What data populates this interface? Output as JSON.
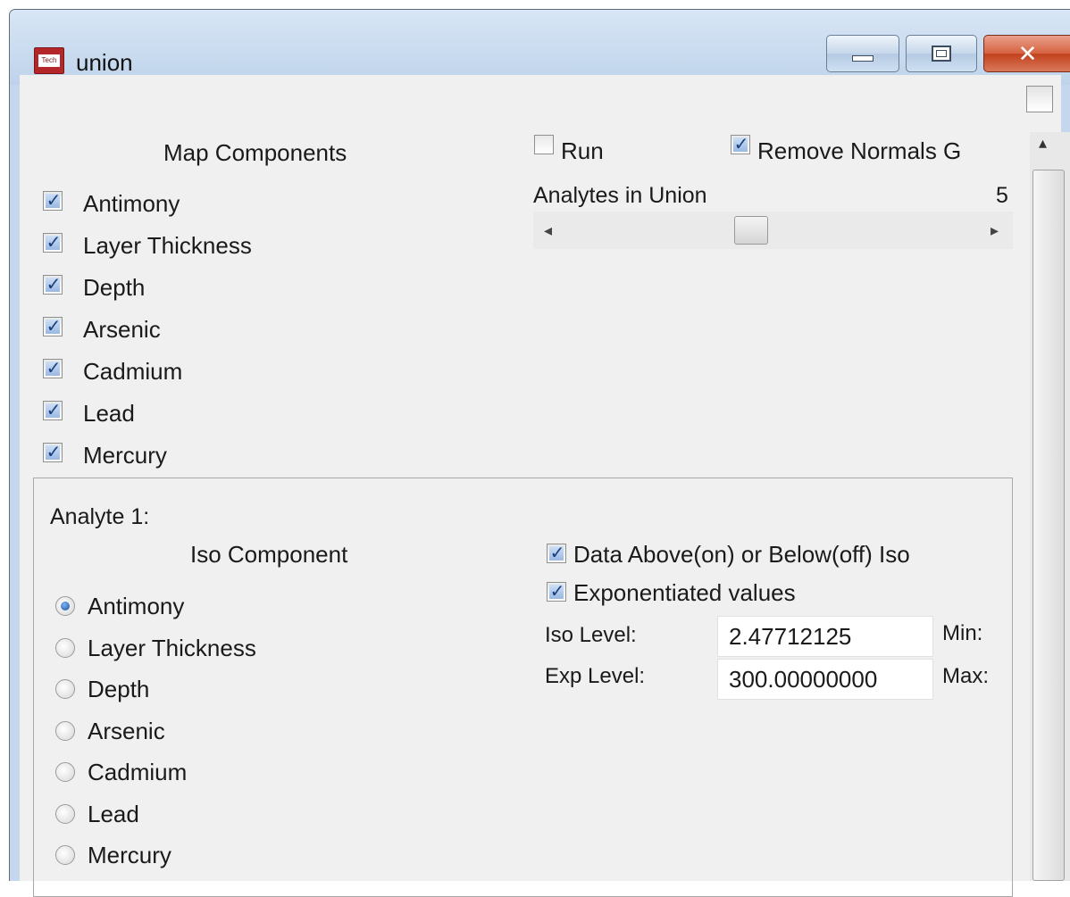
{
  "window": {
    "title": "union",
    "icon_text": "Tech",
    "close_glyph": "✕"
  },
  "map_components": {
    "heading": "Map Components",
    "items": [
      {
        "label": "Antimony",
        "checked": true
      },
      {
        "label": "Layer Thickness",
        "checked": true
      },
      {
        "label": "Depth",
        "checked": true
      },
      {
        "label": "Arsenic",
        "checked": true
      },
      {
        "label": "Cadmium",
        "checked": true
      },
      {
        "label": "Lead",
        "checked": true
      },
      {
        "label": "Mercury",
        "checked": true
      }
    ]
  },
  "options": {
    "run_label": "Run",
    "run_checked": false,
    "remove_normals_label": "Remove Normals G",
    "remove_normals_checked": true,
    "analytes_in_union_label": "Analytes in Union",
    "analytes_in_union_value": "5"
  },
  "analyte": {
    "group_label": "Analyte 1:",
    "iso_component_heading": "Iso Component",
    "components": [
      {
        "label": "Antimony",
        "selected": true
      },
      {
        "label": "Layer Thickness",
        "selected": false
      },
      {
        "label": "Depth",
        "selected": false
      },
      {
        "label": "Arsenic",
        "selected": false
      },
      {
        "label": "Cadmium",
        "selected": false
      },
      {
        "label": "Lead",
        "selected": false
      },
      {
        "label": "Mercury",
        "selected": false
      }
    ],
    "data_above_label": "Data Above(on) or Below(off) Iso",
    "data_above_checked": true,
    "exponentiated_label": "Exponentiated values",
    "exponentiated_checked": true,
    "iso_level_label": "Iso Level:",
    "iso_level_value": "2.47712125",
    "exp_level_label": "Exp Level:",
    "exp_level_value": "300.00000000",
    "min_label": "Min:",
    "max_label": "Max:"
  },
  "glyphs": {
    "check": "✓",
    "left_arrow": "◂",
    "right_arrow": "▸",
    "up_arrow": "▴"
  }
}
